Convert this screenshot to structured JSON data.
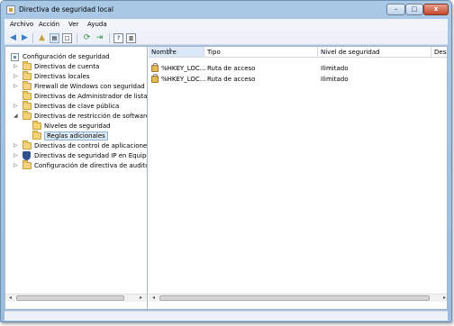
{
  "window": {
    "title": "Directiva de seguridad local"
  },
  "window_controls": {
    "minimize": "–",
    "maximize": "□",
    "close": "x"
  },
  "menu": [
    {
      "label": "Archivo"
    },
    {
      "label": "Acción"
    },
    {
      "label": "Ver"
    },
    {
      "label": "Ayuda"
    }
  ],
  "toolbar": {
    "back": "◀",
    "forward": "▶",
    "up_folder": "📁",
    "show_tree": "▤",
    "export": "□",
    "refresh": "⟳",
    "export_list": "⇥",
    "help": "?",
    "properties": "▥"
  },
  "tree": {
    "items": [
      {
        "label": "Configuración de seguridad",
        "expander": "",
        "icon": "root-icon"
      },
      {
        "label": "Directivas de cuenta",
        "expander": "▷",
        "icon": "folder-icon"
      },
      {
        "label": "Directivas locales",
        "expander": "▷",
        "icon": "folder-icon"
      },
      {
        "label": "Firewall de Windows con seguridad av",
        "expander": "▷",
        "icon": "folder-icon"
      },
      {
        "label": "Directivas de Administrador de listas d",
        "expander": "",
        "icon": "folder-icon"
      },
      {
        "label": "Directivas de clave pública",
        "expander": "▷",
        "icon": "folder-icon"
      },
      {
        "label": "Directivas de restricción de software",
        "expander": "◢",
        "icon": "folder-icon"
      },
      {
        "label": "Niveles de seguridad",
        "expander": "",
        "icon": "folder-icon"
      },
      {
        "label": "Reglas adicionales",
        "expander": "",
        "icon": "folder-icon",
        "selected": true
      },
      {
        "label": "Directivas de control de aplicaciones",
        "expander": "▷",
        "icon": "folder-icon"
      },
      {
        "label": "Directivas de seguridad IP en Equipo l",
        "expander": "▷",
        "icon": "shield-icon"
      },
      {
        "label": "Configuración de directiva de auditor",
        "expander": "▷",
        "icon": "folder-icon"
      }
    ]
  },
  "list": {
    "columns": [
      "Nombre",
      "Tipo",
      "Nivel de seguridad",
      "Desc"
    ],
    "rows": [
      {
        "name": "%HKEY_LOC...",
        "type": "Ruta de acceso",
        "level": "Ilimitado"
      },
      {
        "name": "%HKEY_LOC...",
        "type": "Ruta de acceso",
        "level": "Ilimitado"
      }
    ]
  },
  "scroll": {
    "left": "◂",
    "right": "▸"
  },
  "colors": {
    "title_bar": "#a9c8e6",
    "selection": "#dceaf8",
    "close_button": "#c2482c"
  }
}
